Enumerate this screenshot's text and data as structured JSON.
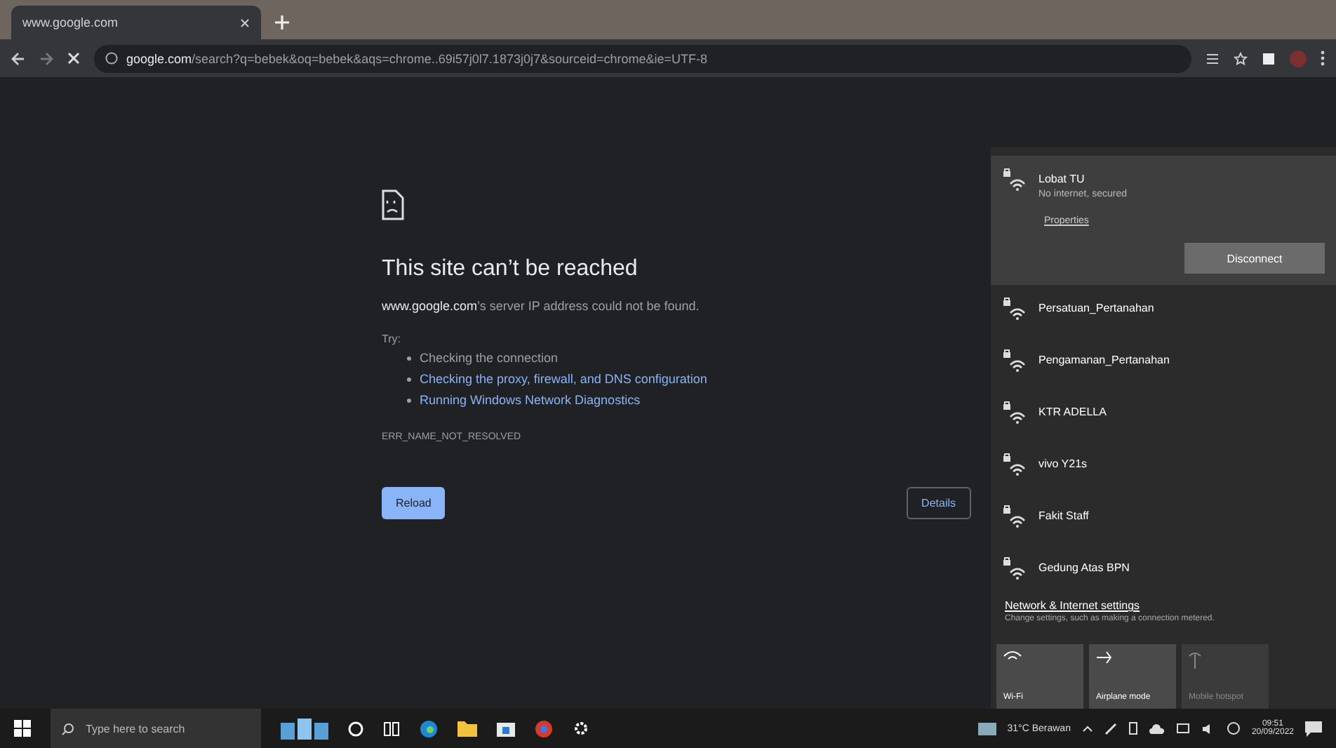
{
  "browser": {
    "tabs": [
      {
        "title": "www.google.com",
        "selected": true
      }
    ],
    "address": "**google.com**/search?q=bebek&oq=bebek&aqs=chrome..69i57j0l7.1873j0j7&sourceid=chrome&ie=UTF-8"
  },
  "error_page": {
    "title": "This site can’t be reached",
    "message": "**www.google.com**’s server IP address could not be found.",
    "try_label": "Try:",
    "suggestions": [
      {
        "text": "Checking the connection",
        "kind": "plain"
      },
      {
        "text": "Checking the proxy, firewall, and DNS configuration",
        "kind": "link"
      },
      {
        "text": "Running Windows Network Diagnostics",
        "kind": "link"
      }
    ],
    "error_code": "ERR_NAME_NOT_RESOLVED",
    "reload_button": "Reload",
    "details_button": "Details"
  },
  "network_flyout": {
    "networks": [
      {
        "name": "Lobat TU",
        "selected": true,
        "status": "No internet, secured",
        "properties": "Properties",
        "action": "Disconnect"
      },
      {
        "name": "Persatuan_Pertanahan",
        "selected": false
      },
      {
        "name": "Pengamanan_Pertanahan",
        "selected": false
      },
      {
        "name": "KTR ADELLA",
        "selected": false
      },
      {
        "name": "vivo Y21s",
        "selected": false
      },
      {
        "name": "Fakit Staff",
        "selected": false
      },
      {
        "name": "Gedung Atas BPN",
        "selected": false
      }
    ],
    "settings_link": "Network & Internet settings",
    "settings_hint": "Change settings, such as making a connection metered.",
    "quick_actions": [
      {
        "label": "Wi-Fi",
        "kind": "wifi",
        "disabled": false
      },
      {
        "label": "Airplane mode",
        "kind": "airplane",
        "disabled": false
      },
      {
        "label": "Mobile hotspot",
        "kind": "hotspot",
        "disabled": true
      }
    ]
  },
  "taskbar": {
    "search_placeholder": "Type here to search",
    "weather": "31°C Berawan",
    "time": "09:51",
    "date": "20/09/2022"
  }
}
